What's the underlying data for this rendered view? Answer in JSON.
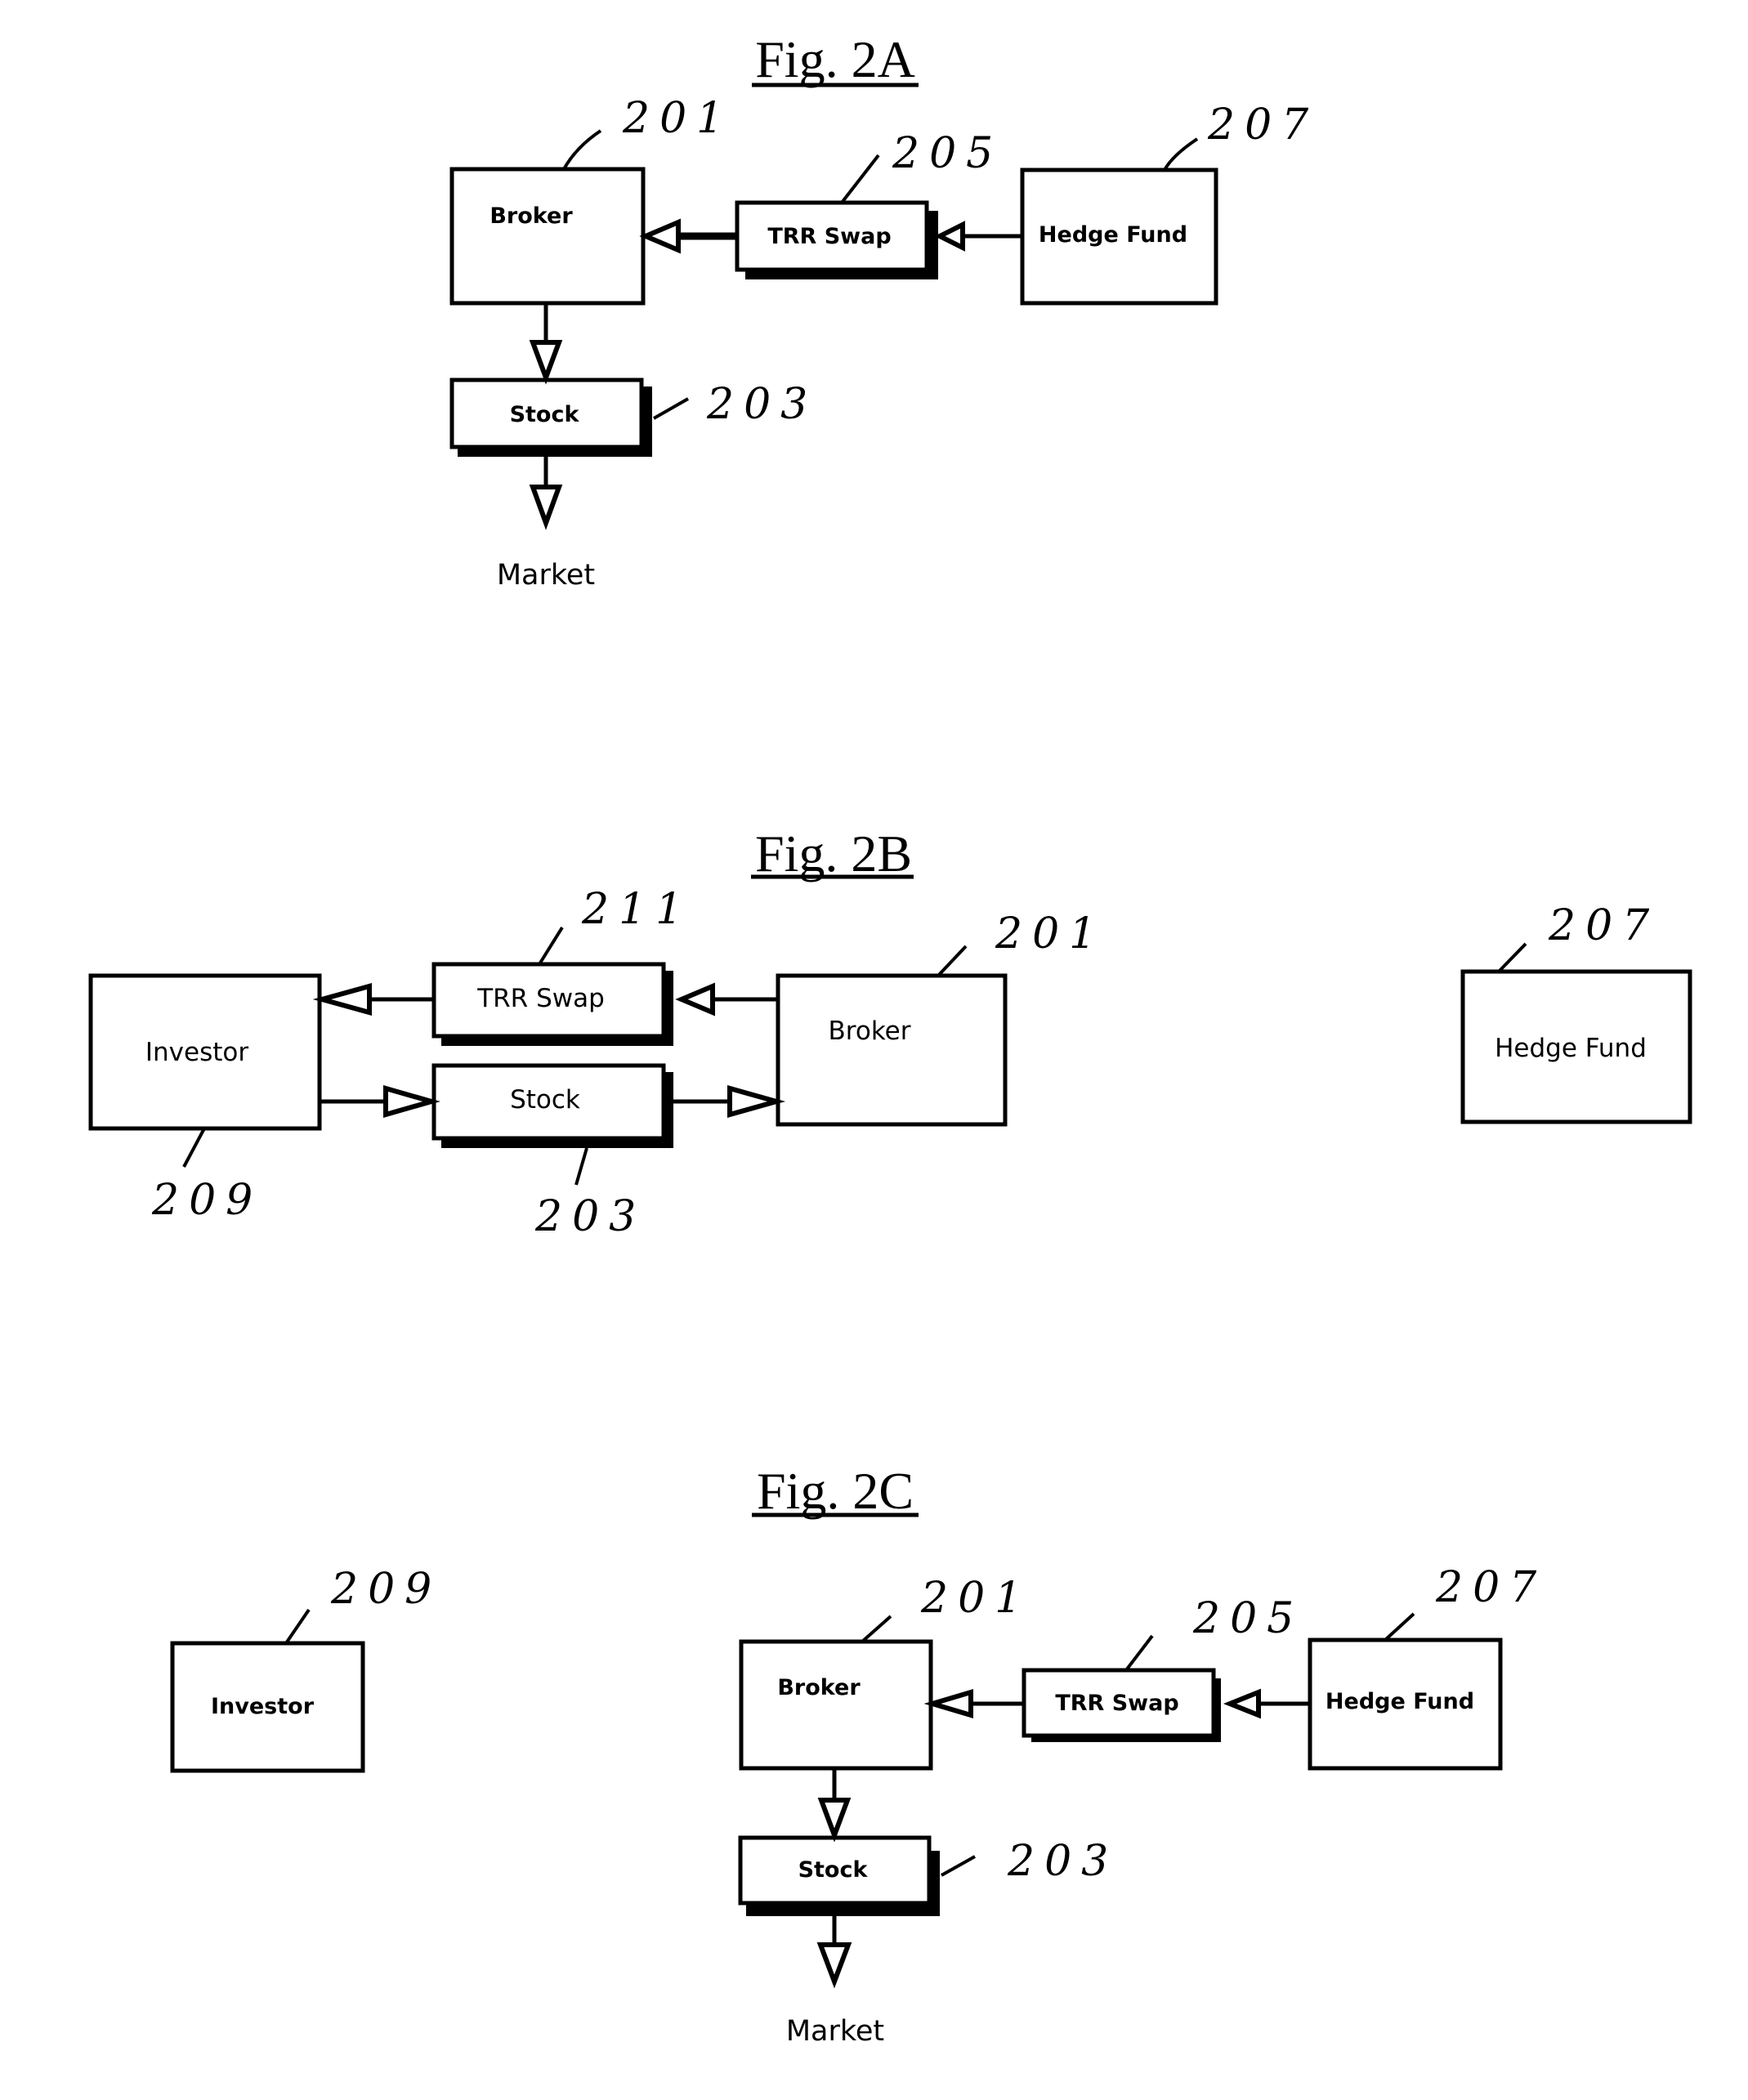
{
  "figures": {
    "fig2a": {
      "title": "Fig. 2A",
      "nodes": {
        "broker": {
          "label": "Broker",
          "ref": "201"
        },
        "trr_swap": {
          "label": "TRR Swap",
          "ref": "205"
        },
        "hedge_fund": {
          "label": "Hedge Fund",
          "ref": "207"
        },
        "stock": {
          "label": "Stock",
          "ref": "203"
        },
        "market": {
          "label": "Market"
        }
      },
      "edges": [
        {
          "from": "hedge_fund",
          "to": "trr_swap"
        },
        {
          "from": "trr_swap",
          "to": "broker"
        },
        {
          "from": "broker",
          "to": "stock"
        },
        {
          "from": "stock",
          "to": "market"
        }
      ]
    },
    "fig2b": {
      "title": "Fig. 2B",
      "nodes": {
        "investor": {
          "label": "Investor",
          "ref": "209"
        },
        "trr_swap": {
          "label": "TRR Swap",
          "ref": "211"
        },
        "stock": {
          "label": "Stock",
          "ref": "203"
        },
        "broker": {
          "label": "Broker",
          "ref": "201"
        },
        "hedge_fund": {
          "label": "Hedge Fund",
          "ref": "207"
        }
      },
      "edges": [
        {
          "from": "broker",
          "to": "trr_swap"
        },
        {
          "from": "trr_swap",
          "to": "investor"
        },
        {
          "from": "investor",
          "to": "stock"
        },
        {
          "from": "stock",
          "to": "broker"
        }
      ]
    },
    "fig2c": {
      "title": "Fig. 2C",
      "nodes": {
        "investor": {
          "label": "Investor",
          "ref": "209"
        },
        "broker": {
          "label": "Broker",
          "ref": "201"
        },
        "trr_swap": {
          "label": "TRR Swap",
          "ref": "205"
        },
        "hedge_fund": {
          "label": "Hedge Fund",
          "ref": "207"
        },
        "stock": {
          "label": "Stock",
          "ref": "203"
        },
        "market": {
          "label": "Market"
        }
      },
      "edges": [
        {
          "from": "hedge_fund",
          "to": "trr_swap"
        },
        {
          "from": "trr_swap",
          "to": "broker"
        },
        {
          "from": "broker",
          "to": "stock"
        },
        {
          "from": "stock",
          "to": "market"
        }
      ]
    }
  }
}
